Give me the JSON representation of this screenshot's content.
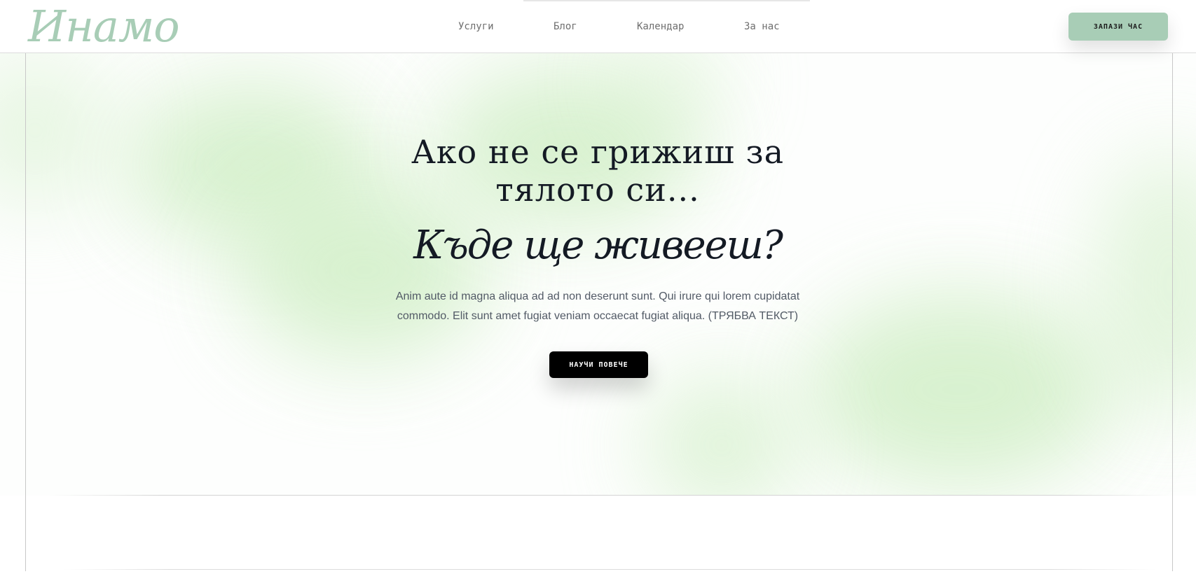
{
  "brand": {
    "logo_text": "Инамо",
    "accent_color": "#a8cdb6",
    "blob_color": "#d2efc8"
  },
  "nav": {
    "items": [
      {
        "label": "Услуги"
      },
      {
        "label": "Блог"
      },
      {
        "label": "Календар"
      },
      {
        "label": "За нас"
      }
    ],
    "cta_label": "ЗАПАЗИ ЧАС"
  },
  "hero": {
    "headline_line1": "Ако не се грижиш за",
    "headline_line2": "тялото си...",
    "headline_script": "Къде ще живееш?",
    "subtext": "Anim aute id magna aliqua ad ad non deserunt sunt. Qui irure qui lorem cupidatat commodo. Elit sunt amet fugiat veniam occaecat fugiat aliqua. (ТРЯБВА ТЕКСТ)",
    "button_label": "НАУЧИ ПОВЕЧЕ",
    "text_color": "#141a24"
  }
}
